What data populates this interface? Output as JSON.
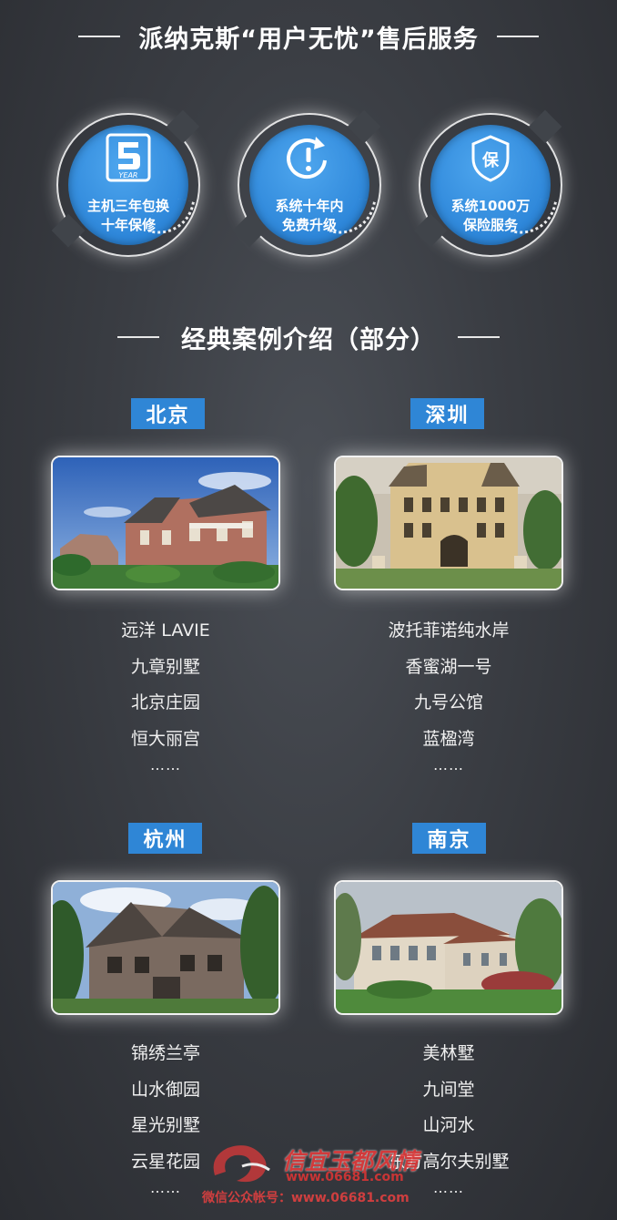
{
  "header": {
    "title": "派纳克斯“用户无忧”售后服务"
  },
  "services": [
    {
      "icon": "five-year-icon",
      "line1": "主机三年包换",
      "line2": "十年保修",
      "icon_label": "YEAR"
    },
    {
      "icon": "upgrade-clock-icon",
      "line1": "系统十年内",
      "line2": "免费升级"
    },
    {
      "icon": "shield-insurance-icon",
      "line1": "系统1000万",
      "line2": "保险服务",
      "icon_label": "保"
    }
  ],
  "cases": {
    "title": "经典案例介绍（部分）",
    "cities": [
      {
        "name": "北京",
        "items": [
          "远洋 LAVIE",
          "九章别墅",
          "北京庄园",
          "恒大丽宫"
        ],
        "more": "……"
      },
      {
        "name": "深圳",
        "items": [
          "波托菲诺纯水岸",
          "香蜜湖一号",
          "九号公馆",
          "蓝楹湾"
        ],
        "more": "……"
      },
      {
        "name": "杭州",
        "items": [
          "锦绣兰亭",
          "山水御园",
          "星光别墅",
          "云星花园"
        ],
        "more": "……"
      },
      {
        "name": "南京",
        "items": [
          "美林墅",
          "九间堂",
          "山河水",
          "东方高尔夫别墅"
        ],
        "more": "……"
      }
    ]
  },
  "watermark": {
    "line1": "信宜玉都风情",
    "line2": "www.06681.com",
    "line3": "微信公众帐号：www.06681.com"
  },
  "colors": {
    "accent": "#2f86d6",
    "background": "#3a3d43"
  }
}
